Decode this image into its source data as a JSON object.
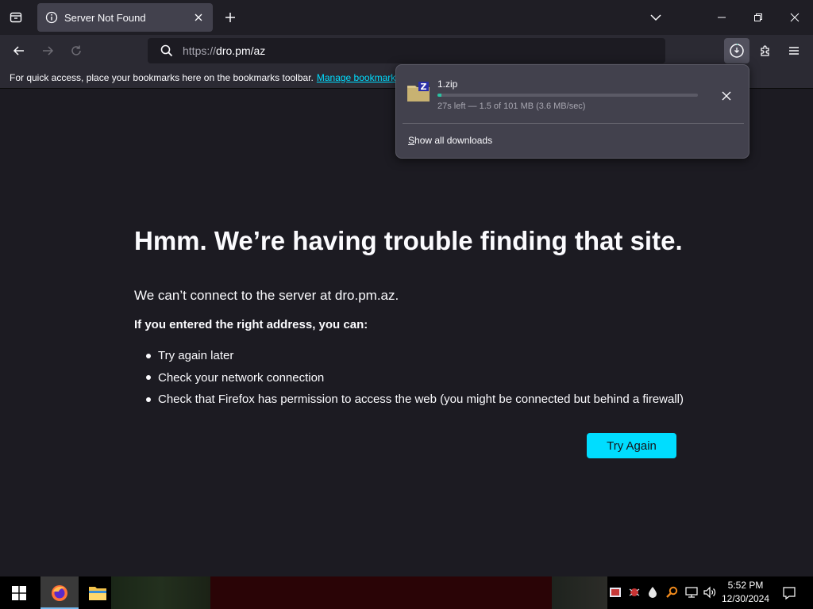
{
  "tab": {
    "title": "Server Not Found"
  },
  "navbar": {
    "url_scheme": "https://",
    "url_host": "dro.pm/az"
  },
  "bookmarks": {
    "message": "For quick access, place your bookmarks here on the bookmarks toolbar.",
    "manage_link": "Manage bookmarks"
  },
  "error": {
    "title": "Hmm. We’re having trouble finding that site.",
    "description": "We can’t connect to the server at dro.pm.az.",
    "subtitle": "If you entered the right address, you can:",
    "suggestions": [
      "Try again later",
      "Check your network connection",
      "Check that Firefox has permission to access the web (you might be connected but behind a firewall)"
    ],
    "button": "Try Again"
  },
  "downloads": {
    "file_name": "1.zip",
    "status": "27s left — 1.5 of 101 MB (3.6 MB/sec)",
    "progress": 0.015,
    "show_all_first": "S",
    "show_all_rest": "how all downloads"
  },
  "clock": {
    "time": "5:52 PM",
    "date": "12/30/2024"
  },
  "colors": {
    "accent": "#00ddff",
    "progress": "#2ac3a2",
    "background": "#1c1b22",
    "toolbar": "#2b2a33"
  }
}
